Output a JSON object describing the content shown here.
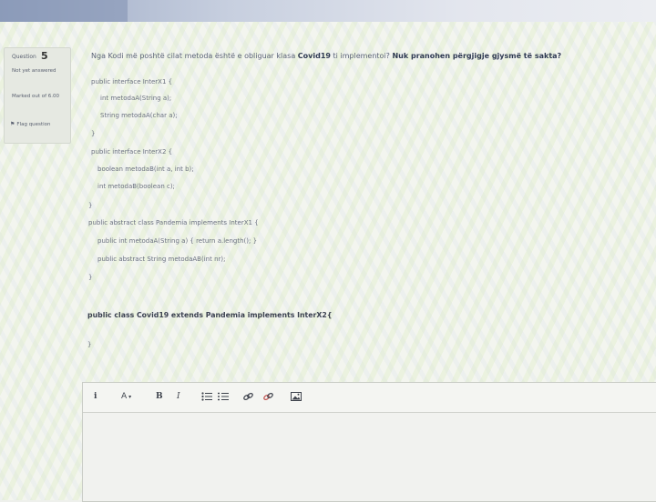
{
  "question": {
    "label": "Question",
    "number": "5",
    "state": "Not yet answered",
    "marked": "Marked out of 6.00",
    "flag_label": "Flag question"
  },
  "prompt": {
    "text_start": "Nga Kodi më poshtë cilat metoda është e obliguar klasa ",
    "class_name": "Covid19",
    "text_mid": " ti implementoi? ",
    "note": "Nuk pranohen përgjigje gjysmë të sakta?"
  },
  "code": [
    "public interface InterX1 {",
    "int metodaA(String a);",
    "String metodaA(char a);",
    "}",
    "public interface InterX2 {",
    "boolean metodaB(int a, int b);",
    "int metodaB(boolean c);",
    "}",
    "public abstract class Pandemia implements InterX1 {",
    "public int metodaA(String a) { return a.length(); }",
    "public abstract String metodaAB(int nr);",
    "}"
  ],
  "class_decl": "public class Covid19 extends Pandemia implements InterX2{",
  "class_close": "}",
  "editor": {
    "toolbar": {
      "info": "i",
      "font_size": "A",
      "bold": "B",
      "italic": "I"
    }
  }
}
